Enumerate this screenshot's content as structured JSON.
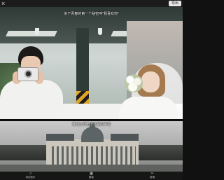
{
  "header": {
    "close_icon": "close-icon",
    "export_label": "导出"
  },
  "captions": {
    "scene1": "关于青春的第一个秘密叫\"我喜欢你\"",
    "scene2": "我们之间无法逃避的幸福"
  },
  "toolbar": {
    "items": [
      {
        "icon": "music-icon",
        "label": "添加音乐"
      },
      {
        "icon": "template-icon",
        "label": "模板"
      },
      {
        "icon": "edit-icon",
        "label": "剪辑"
      }
    ]
  },
  "colors": {
    "background": "#111111",
    "pole_stripe": "#e0a51c"
  }
}
